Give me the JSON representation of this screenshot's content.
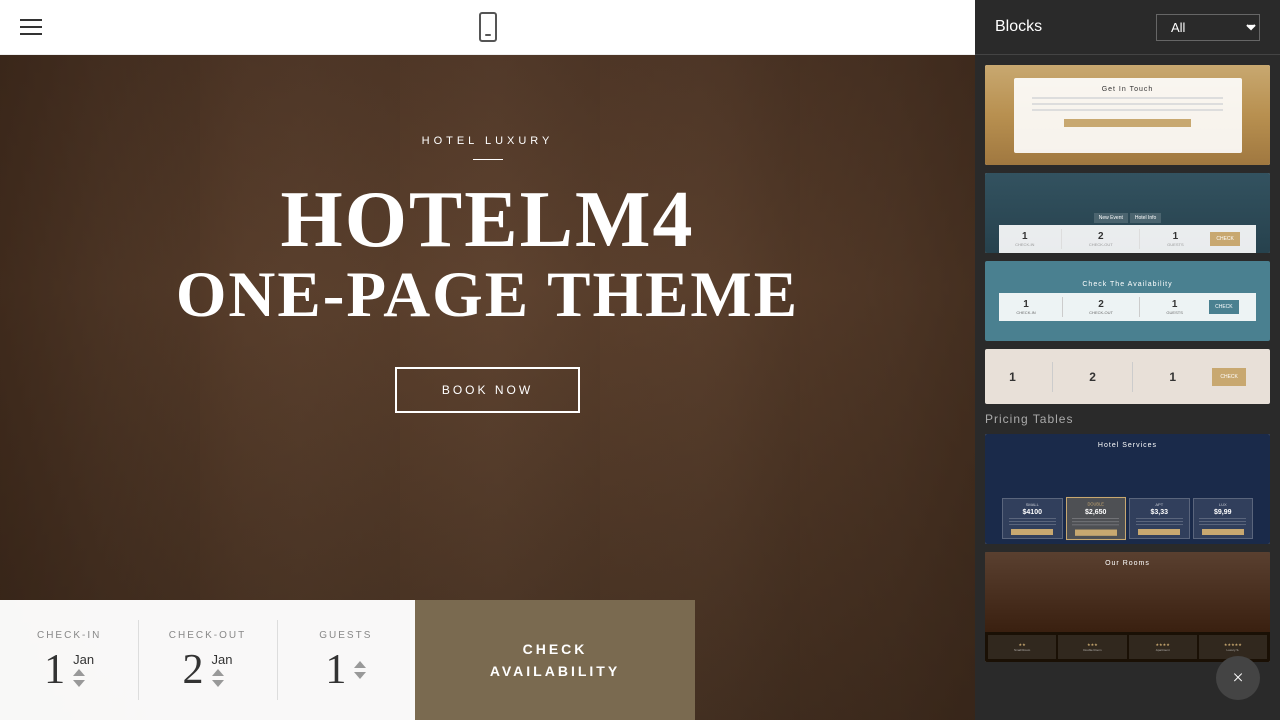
{
  "topbar": {
    "hamburger_label": "menu"
  },
  "hero": {
    "category_label": "HOTEL LUXURY",
    "title_line1": "HOTELM4",
    "title_line2": "ONE-PAGE THEME",
    "book_now_label": "BOOK NOW"
  },
  "booking": {
    "checkin_label": "CHECK-IN",
    "checkin_number": "1",
    "checkin_month": "Jan",
    "checkout_label": "CHECK-OUT",
    "checkout_number": "2",
    "checkout_month": "Jan",
    "guests_label": "GUESTS",
    "guests_number": "1",
    "check_availability_label": "CHECK\nAVAILABILITY"
  },
  "right_panel": {
    "blocks_title": "Blocks",
    "all_dropdown_label": "All",
    "pricing_tables_label": "Pricing Tables",
    "block_thumbs": [
      {
        "id": "contact-form",
        "type": "contact"
      },
      {
        "id": "reservation-tabs",
        "type": "reservation-tabs"
      },
      {
        "id": "check-availability",
        "type": "check-avail"
      },
      {
        "id": "simple-bar",
        "type": "simple-bar"
      }
    ],
    "pricing_block": {
      "id": "hotel-services",
      "title": "Hotel Services"
    },
    "rooms_block": {
      "id": "our-rooms",
      "title": "Our Rooms"
    },
    "room_types": [
      {
        "stars": "★★",
        "label": "Small Room"
      },
      {
        "stars": "★★★",
        "label": "Double Room"
      },
      {
        "stars": "★★★★",
        "label": "Apartment"
      },
      {
        "stars": "★★★★★",
        "label": "Luxury S."
      }
    ]
  },
  "close_button": {
    "label": "×"
  }
}
